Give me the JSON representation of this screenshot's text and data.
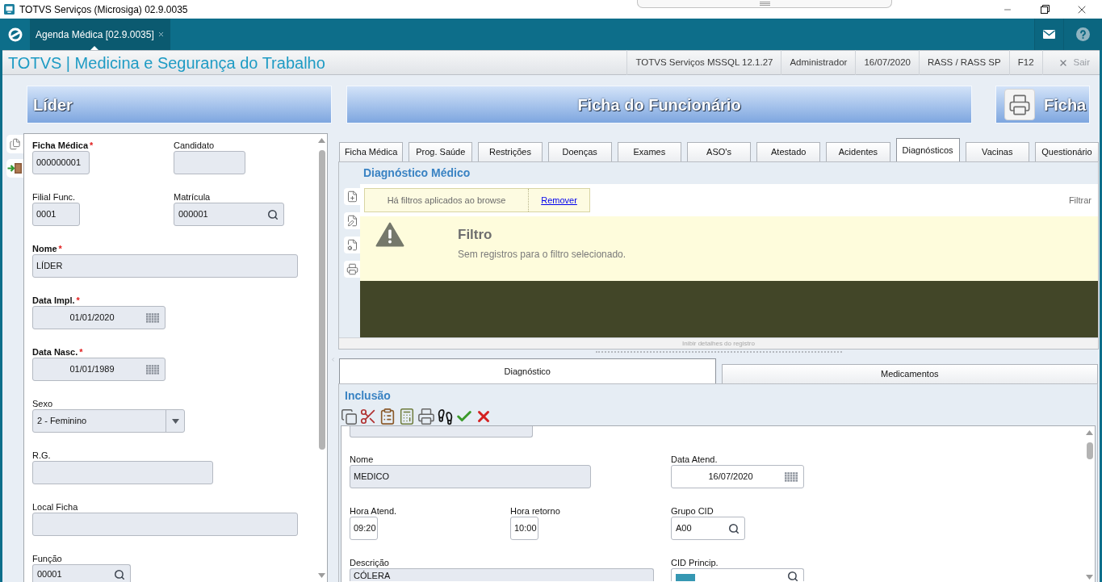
{
  "window": {
    "title": "TOTVS Serviços (Microsiga) 02.9.0035"
  },
  "app_tabs": [
    {
      "label": "Agenda Médica [02.9.0035]",
      "selected": true
    }
  ],
  "header": {
    "title": "TOTVS | Medicina e Segurança do Trabalho",
    "info": [
      "TOTVS Serviços MSSQL 12.1.27",
      "Administrador",
      "16/07/2020",
      "RASS / RASS SP",
      "F12"
    ],
    "exit_button": "Sair"
  },
  "banners": {
    "left_title": "Líder",
    "center_title": "Ficha do Funcionário",
    "print_button": "Ficha"
  },
  "employee_form": {
    "rows": [
      [
        {
          "label": "Ficha Médica",
          "required": true,
          "required_mark": "*",
          "kind": "text",
          "value": "000000001",
          "disabled": true
        },
        {
          "label": "Candidato",
          "required": false,
          "kind": "text",
          "disabled": true
        }
      ],
      [
        {
          "label": "Filial Func.",
          "required": false,
          "kind": "text",
          "value": "0001",
          "disabled": true
        },
        {
          "label": "Matrícula",
          "required": false,
          "kind": "lookup",
          "value": "000001",
          "disabled": true
        }
      ],
      [
        {
          "label": "Nome",
          "required": true,
          "required_mark": "*",
          "kind": "text",
          "value": "LÍDER",
          "disabled": true
        }
      ],
      [
        {
          "label": "Data Impl.",
          "required": true,
          "required_mark": "*",
          "kind": "date",
          "value": "01/01/2020",
          "disabled": true
        }
      ],
      [
        {
          "label": "Data Nasc.",
          "required": true,
          "required_mark": "*",
          "kind": "date",
          "value": "01/01/1989",
          "disabled": true
        }
      ],
      [
        {
          "label": "Sexo",
          "required": false,
          "kind": "select",
          "value": "2 - Feminino",
          "disabled": true
        }
      ],
      [
        {
          "label": "R.G.",
          "required": false,
          "kind": "text",
          "disabled": true
        }
      ],
      [
        {
          "label": "Local Ficha",
          "required": false,
          "kind": "text",
          "disabled": true
        }
      ],
      [
        {
          "label": "Função",
          "required": false,
          "kind": "lookup",
          "value": "00001",
          "disabled": true
        }
      ]
    ]
  },
  "record_tabs": [
    {
      "label": "Ficha Médica",
      "selected": false
    },
    {
      "label": "Prog. Saúde",
      "selected": false
    },
    {
      "label": "Restrições",
      "selected": false
    },
    {
      "label": "Doenças",
      "selected": false
    },
    {
      "label": "Exames",
      "selected": false
    },
    {
      "label": "ASO's",
      "selected": false
    },
    {
      "label": "Atestado",
      "selected": false
    },
    {
      "label": "Acidentes",
      "selected": false
    },
    {
      "label": "Diagnósticos",
      "selected": true
    },
    {
      "label": "Vacinas",
      "selected": false
    },
    {
      "label": "Questionário",
      "selected": false
    }
  ],
  "diagnosis_browse": {
    "title": "Diagnóstico Médico",
    "filter_notice": "Há filtros aplicados ao browse",
    "remove_link": "Remover",
    "filter_button": "Filtrar",
    "empty_state": {
      "title": "Filtro",
      "message": "Sem registros para o filtro selecionado."
    },
    "details_toggle": "Inibir detalhes do registro"
  },
  "detail_tabs": [
    {
      "label": "Diagnóstico",
      "selected": true
    },
    {
      "label": "Medicamentos",
      "selected": false
    }
  ],
  "inclusion_form": {
    "title": "Inclusão",
    "cut_field": {
      "disabled": true
    },
    "rows": [
      [
        {
          "label": "Nome",
          "required": false,
          "kind": "text",
          "value": "MEDICO",
          "disabled": true
        },
        {
          "label": "Data Atend.",
          "required": false,
          "kind": "date",
          "value": "16/07/2020",
          "disabled": false
        }
      ],
      [
        {
          "label": "Hora Atend.",
          "required": false,
          "kind": "text",
          "value": "09:20",
          "disabled": false
        },
        {
          "label": "Hora retorno",
          "required": false,
          "kind": "text",
          "value": "10:00",
          "disabled": false
        },
        {
          "label": "Grupo CID",
          "required": false,
          "kind": "lookup",
          "value": "A00",
          "disabled": false
        }
      ],
      [
        {
          "label": "Descrição",
          "required": false,
          "kind": "text",
          "value": "CÓLERA",
          "disabled": true
        },
        {
          "label": "CID Princip.",
          "required": false,
          "kind": "lookup_swatch",
          "disabled": false
        }
      ]
    ]
  }
}
